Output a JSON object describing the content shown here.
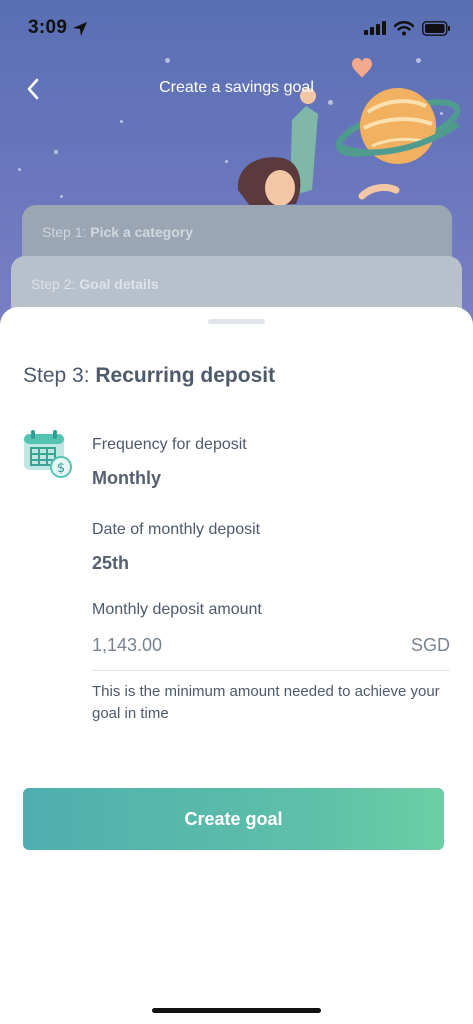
{
  "status_bar": {
    "time": "3:09",
    "icons": [
      "location-arrow-icon",
      "signal-icon",
      "wifi-icon",
      "battery-icon"
    ]
  },
  "nav": {
    "title": "Create a savings goal",
    "back_icon": "chevron-left-icon"
  },
  "steps": [
    {
      "prefix": "Step 1: ",
      "name": "Pick a category"
    },
    {
      "prefix": "Step 2: ",
      "name": "Goal details"
    }
  ],
  "sheet": {
    "heading_prefix": "Step 3: ",
    "heading_bold": "Recurring deposit",
    "icon": "calendar-dollar-icon",
    "frequency": {
      "label": "Frequency for deposit",
      "value": "Monthly"
    },
    "date": {
      "label": "Date of monthly deposit",
      "value": "25th"
    },
    "amount": {
      "label": "Monthly deposit amount",
      "value": "1,143.00",
      "currency": "SGD"
    },
    "helper": "This is the minimum amount needed to achieve your goal in time",
    "cta_label": "Create goal"
  },
  "colors": {
    "hero_bg": "#6a77bd",
    "cta_start": "#50aeb0",
    "cta_end": "#6ccfa5",
    "text": "#4e5a6a"
  }
}
